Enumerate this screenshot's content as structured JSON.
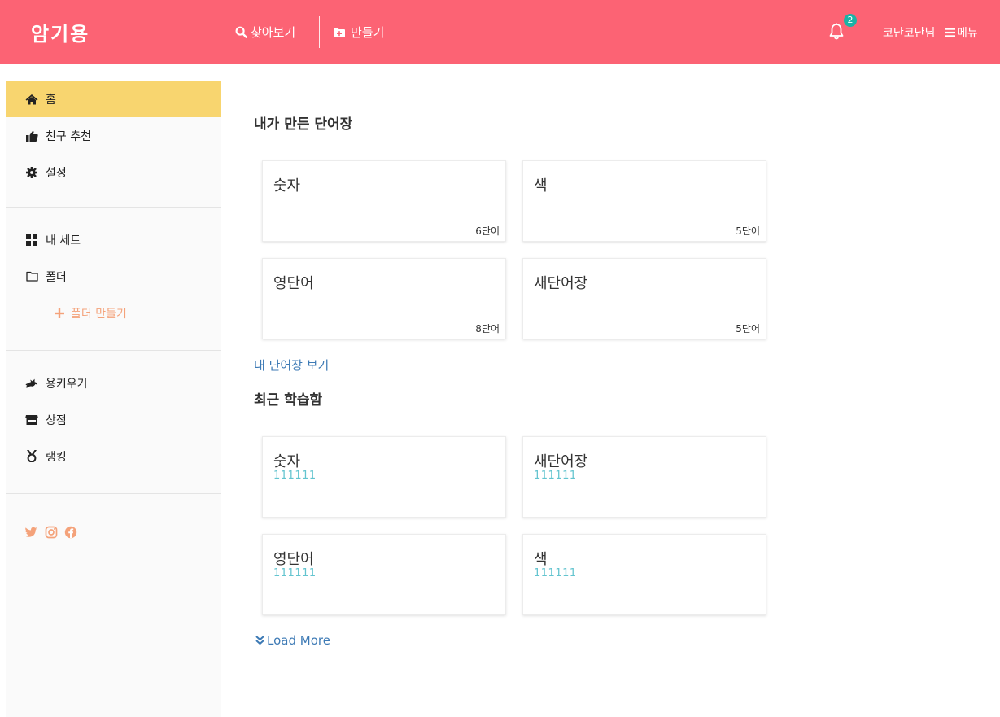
{
  "header": {
    "logo": "암기용",
    "search_label": "찾아보기",
    "create_label": "만들기",
    "notification_count": "2",
    "user_name": "코난코난님",
    "menu_label": "메뉴",
    "bg_color": "#fc6374"
  },
  "sidebar": {
    "home": "홈",
    "friends": "친구 추천",
    "settings": "설정",
    "my_sets": "내 세트",
    "folder": "폴더",
    "folder_add": "폴더 만들기",
    "grow": "용키우기",
    "shop": "상점",
    "ranking": "랭킹",
    "social_icons": [
      "twitter-icon",
      "instagram-icon",
      "facebook-icon"
    ],
    "active_color": "#f8d56f"
  },
  "main": {
    "my_sets_title": "내가 만든 단어장",
    "my_sets": [
      {
        "title": "숫자",
        "count": "6단어"
      },
      {
        "title": "색",
        "count": "5단어"
      },
      {
        "title": "영단어",
        "count": "8단어"
      },
      {
        "title": "새단어장",
        "count": "5단어"
      }
    ],
    "view_my_sets": "내 단어장 보기",
    "recent_title": "최근 학습함",
    "recent": [
      {
        "title": "숫자",
        "author": "111111"
      },
      {
        "title": "새단어장",
        "author": "111111"
      },
      {
        "title": "영단어",
        "author": "111111"
      },
      {
        "title": "색",
        "author": "111111"
      }
    ],
    "load_more": "Load More"
  }
}
